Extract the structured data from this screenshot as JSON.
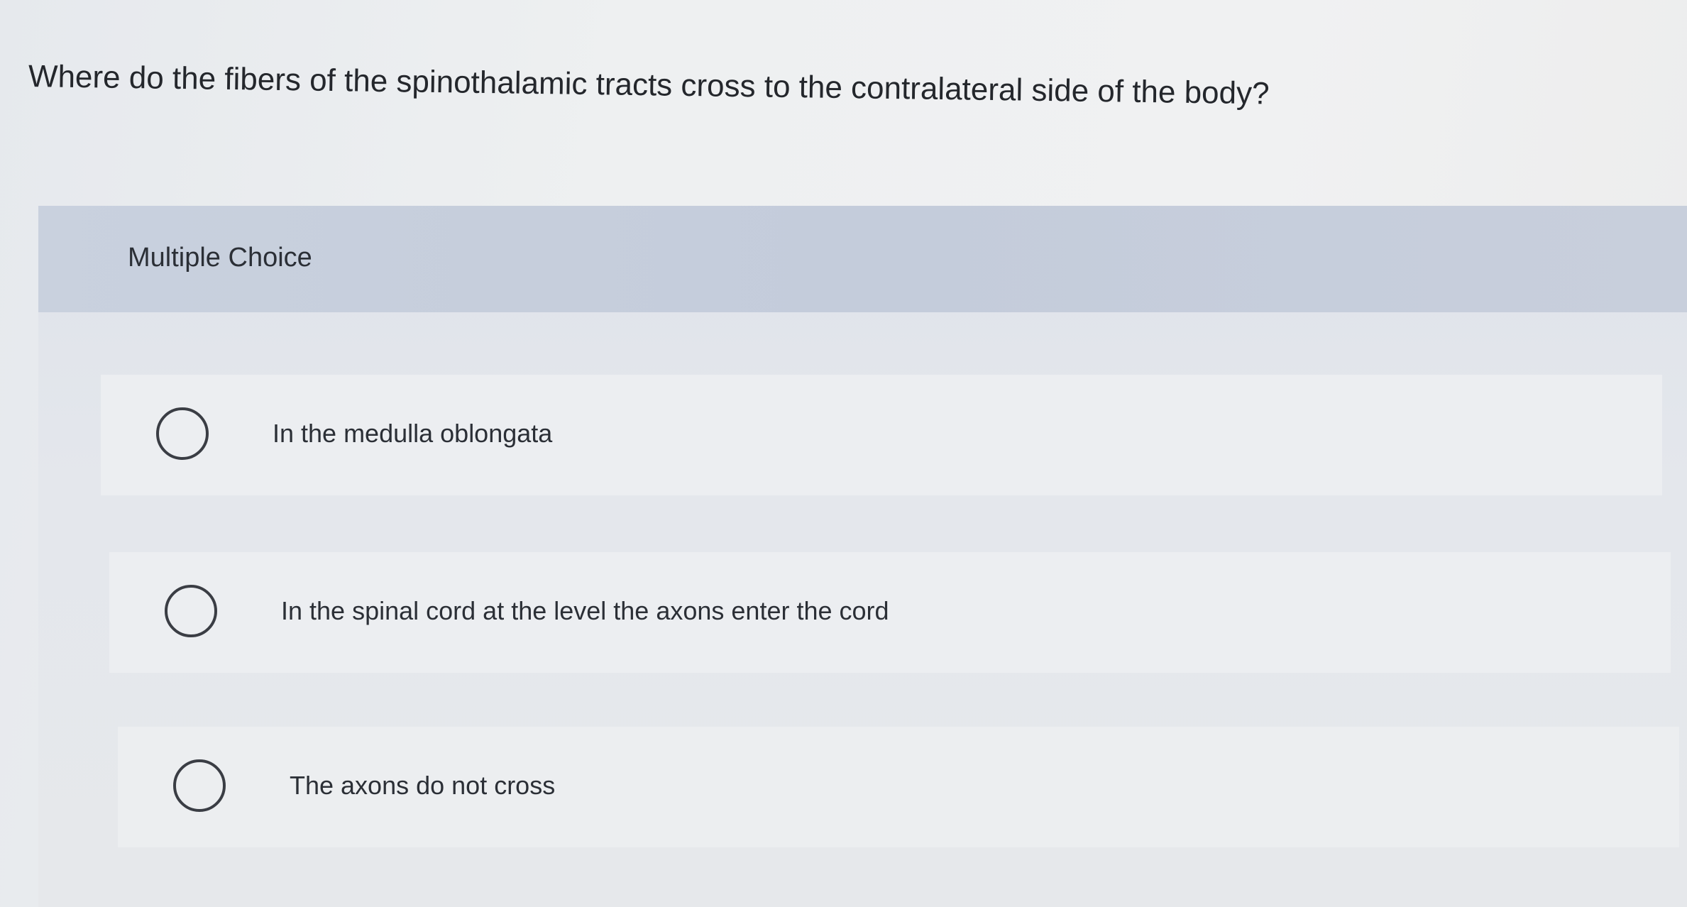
{
  "question": {
    "text": "Where do the fibers of the spinothalamic tracts cross to the contralateral side of the body?"
  },
  "panel": {
    "type_label": "Multiple Choice"
  },
  "options": [
    {
      "label": "In the medulla oblongata",
      "selected": false
    },
    {
      "label": "In the spinal cord at the level the axons enter the cord",
      "selected": false
    },
    {
      "label": "The axons do not cross",
      "selected": false
    }
  ]
}
